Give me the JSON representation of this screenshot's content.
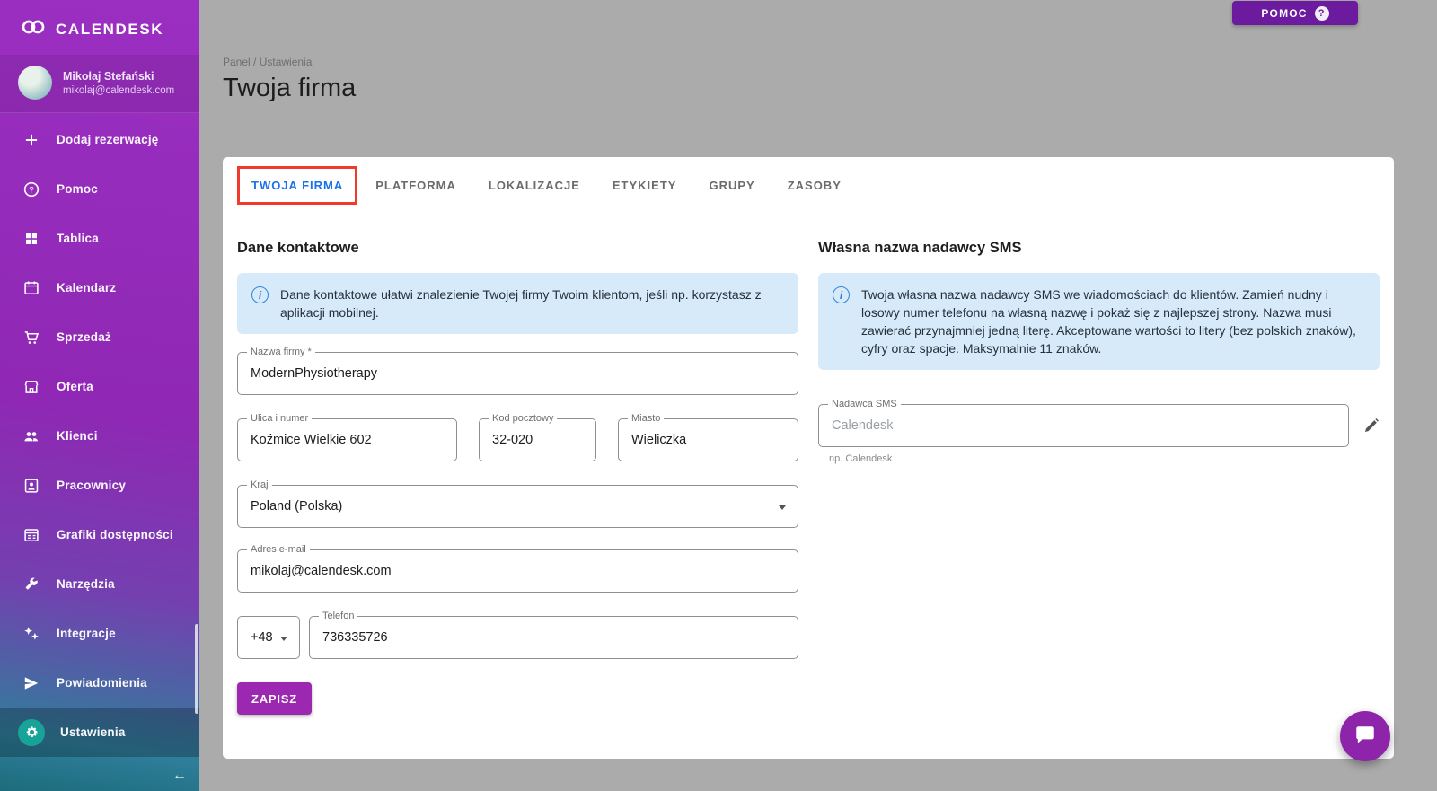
{
  "brand": {
    "name": "CALENDESK"
  },
  "user": {
    "name": "Mikołaj Stefański",
    "email": "mikolaj@calendesk.com"
  },
  "sidebar": {
    "items": [
      {
        "label": "Dodaj rezerwację",
        "icon": "plus-icon"
      },
      {
        "label": "Pomoc",
        "icon": "help-icon"
      },
      {
        "label": "Tablica",
        "icon": "dashboard-icon"
      },
      {
        "label": "Kalendarz",
        "icon": "calendar-icon"
      },
      {
        "label": "Sprzedaż",
        "icon": "cart-icon"
      },
      {
        "label": "Oferta",
        "icon": "storefront-icon"
      },
      {
        "label": "Klienci",
        "icon": "people-icon"
      },
      {
        "label": "Pracownicy",
        "icon": "badge-icon"
      },
      {
        "label": "Grafiki dostępności",
        "icon": "schedule-icon"
      },
      {
        "label": "Narzędzia",
        "icon": "tools-icon"
      },
      {
        "label": "Integracje",
        "icon": "integrations-icon"
      },
      {
        "label": "Powiadomienia",
        "icon": "send-icon"
      },
      {
        "label": "Ustawienia",
        "icon": "gear-icon",
        "active": true
      }
    ]
  },
  "topbar": {
    "help_label": "POMOC"
  },
  "page": {
    "breadcrumb": "Panel / Ustawienia",
    "title": "Twoja firma"
  },
  "tabs": [
    {
      "label": "TWOJA FIRMA",
      "active": true,
      "highlighted": true
    },
    {
      "label": "PLATFORMA"
    },
    {
      "label": "LOKALIZACJE"
    },
    {
      "label": "ETYKIETY"
    },
    {
      "label": "GRUPY"
    },
    {
      "label": "ZASOBY"
    }
  ],
  "contact": {
    "heading": "Dane kontaktowe",
    "info": "Dane kontaktowe ułatwi znalezienie Twojej firmy Twoim klientom, jeśli np. korzystasz z aplikacji mobilnej.",
    "fields": {
      "company_name": {
        "label": "Nazwa firmy *",
        "value": "ModernPhysiotherapy"
      },
      "street": {
        "label": "Ulica i numer",
        "value": "Koźmice Wielkie 602"
      },
      "postal_code": {
        "label": "Kod pocztowy",
        "value": "32-020"
      },
      "city": {
        "label": "Miasto",
        "value": "Wieliczka"
      },
      "country": {
        "label": "Kraj",
        "value": "Poland (Polska)"
      },
      "email": {
        "label": "Adres e-mail",
        "value": "mikolaj@calendesk.com"
      },
      "phone_prefix": {
        "value": "+48"
      },
      "phone": {
        "label": "Telefon",
        "value": "736335726"
      }
    },
    "save_label": "ZAPISZ"
  },
  "sms": {
    "heading": "Własna nazwa nadawcy SMS",
    "info": "Twoja własna nazwa nadawcy SMS we wiadomościach do klientów. Zamień nudny i losowy numer telefonu na własną nazwę i pokaż się z najlepszej strony. Nazwa musi zawierać przynajmniej jedną literę. Akceptowane wartości to litery (bez polskich znaków), cyfry oraz spacje. Maksymalnie 11 znaków.",
    "field": {
      "label": "Nadawca SMS",
      "placeholder": "Calendesk",
      "helper": "np. Calendesk"
    }
  },
  "colors": {
    "sidebar_purple": "#8f28b4",
    "sidebar_teal": "#1c6c7c",
    "accent_purple": "#9c27b0",
    "help_purple": "#6d1b9e",
    "active_tab_blue": "#1a73e8",
    "highlight_red": "#f13a2b",
    "info_box_blue": "#d7eafa",
    "background_gray": "#ababab"
  }
}
